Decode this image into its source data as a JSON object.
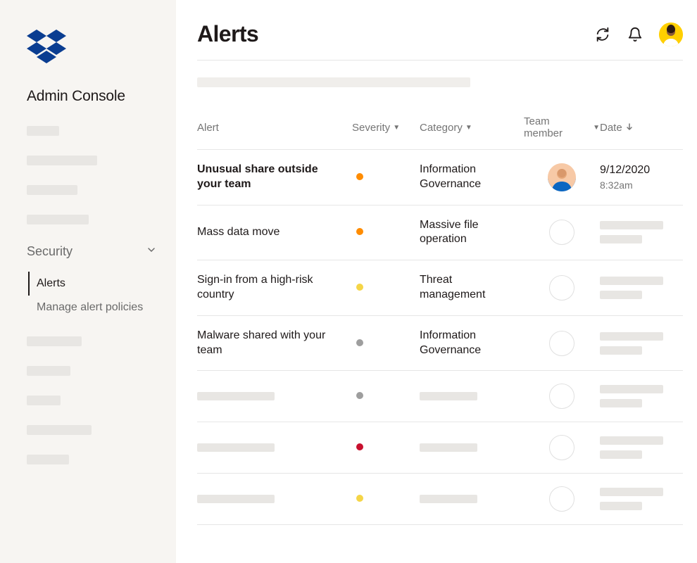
{
  "sidebar": {
    "console_title": "Admin Console",
    "security_label": "Security",
    "subnav": {
      "alerts": "Alerts",
      "policies": "Manage alert policies"
    }
  },
  "header": {
    "title": "Alerts"
  },
  "columns": {
    "alert": "Alert",
    "severity": "Severity",
    "category": "Category",
    "member": "Team member",
    "date": "Date"
  },
  "severity_colors": {
    "orange": "#ff8c00",
    "yellow": "#f5d547",
    "gray": "#9e9e9e",
    "red": "#c8102e"
  },
  "rows": [
    {
      "name": "Unusual share outside your team",
      "bold": true,
      "severity": "orange",
      "category": "Information Governance",
      "member": "avatar",
      "date": "9/12/2020",
      "time": "8:32am"
    },
    {
      "name": "Mass data move",
      "bold": false,
      "severity": "orange",
      "category": "Massive file operation",
      "member": "placeholder",
      "date": null,
      "time": null
    },
    {
      "name": "Sign-in from a high-risk country",
      "bold": false,
      "severity": "yellow",
      "category": "Threat management",
      "member": "placeholder",
      "date": null,
      "time": null
    },
    {
      "name": "Malware shared with your team",
      "bold": false,
      "severity": "gray",
      "category": "Information Governance",
      "member": "placeholder",
      "date": null,
      "time": null
    },
    {
      "name": null,
      "bold": false,
      "severity": "gray",
      "category": null,
      "member": "placeholder",
      "date": null,
      "time": null
    },
    {
      "name": null,
      "bold": false,
      "severity": "red",
      "category": null,
      "member": "placeholder",
      "date": null,
      "time": null
    },
    {
      "name": null,
      "bold": false,
      "severity": "yellow",
      "category": null,
      "member": "placeholder",
      "date": null,
      "time": null
    }
  ]
}
